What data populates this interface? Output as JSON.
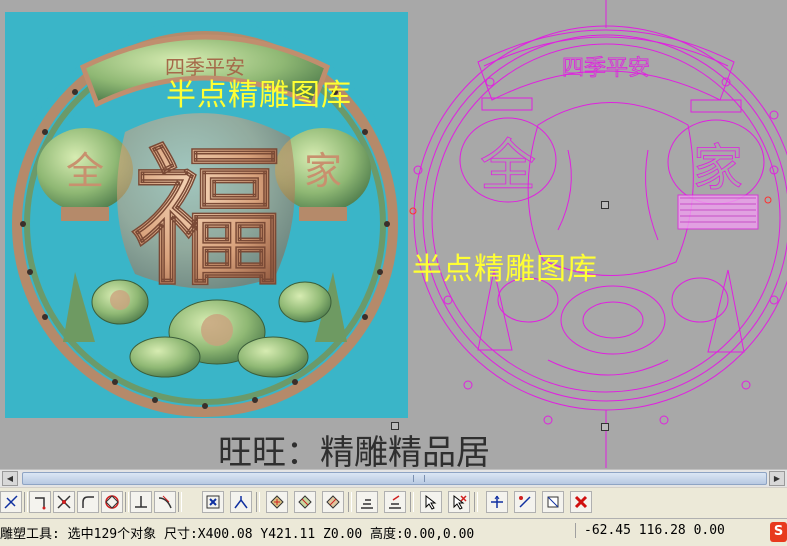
{
  "canvas": {
    "render_panel": {
      "banner_text": "四季平安",
      "center_char": "福",
      "left_lantern_char": "全",
      "right_lantern_char": "家"
    },
    "vector_panel": {
      "banner_text": "四季平安",
      "left_lantern_char": "全",
      "right_lantern_char": "家"
    },
    "watermark_1": "半点精雕图库",
    "watermark_2": "半点精雕图库",
    "caption": "旺旺：精雕精品居"
  },
  "toolbar": {
    "buttons": [
      "trim-icon",
      "corner-icon",
      "intersect-icon",
      "round-corner-icon",
      "node-circle-icon",
      "perpendicular-icon",
      "tangent-icon",
      "snap-point-icon",
      "bend-icon",
      "diamond-1-icon",
      "diamond-2-icon",
      "diamond-3-icon",
      "align-icon",
      "distribute-icon",
      "select-arrow-icon",
      "deselect-arrow-icon",
      "move-icon",
      "rotate-icon",
      "mirror-icon",
      "delete-icon"
    ]
  },
  "status": {
    "left": "雕塑工具: 选中129个对象 尺寸:X400.08 Y421.11 Z0.00 高度:0.00,0.00",
    "right": "-62.45 116.28 0.00"
  },
  "app_icon": "S",
  "colors": {
    "workspace": "#a8a8a8",
    "render_bg": "#3ab5c8",
    "vector_stroke": "#e020e0",
    "watermark": "#ffff33",
    "delete": "#d01010"
  }
}
